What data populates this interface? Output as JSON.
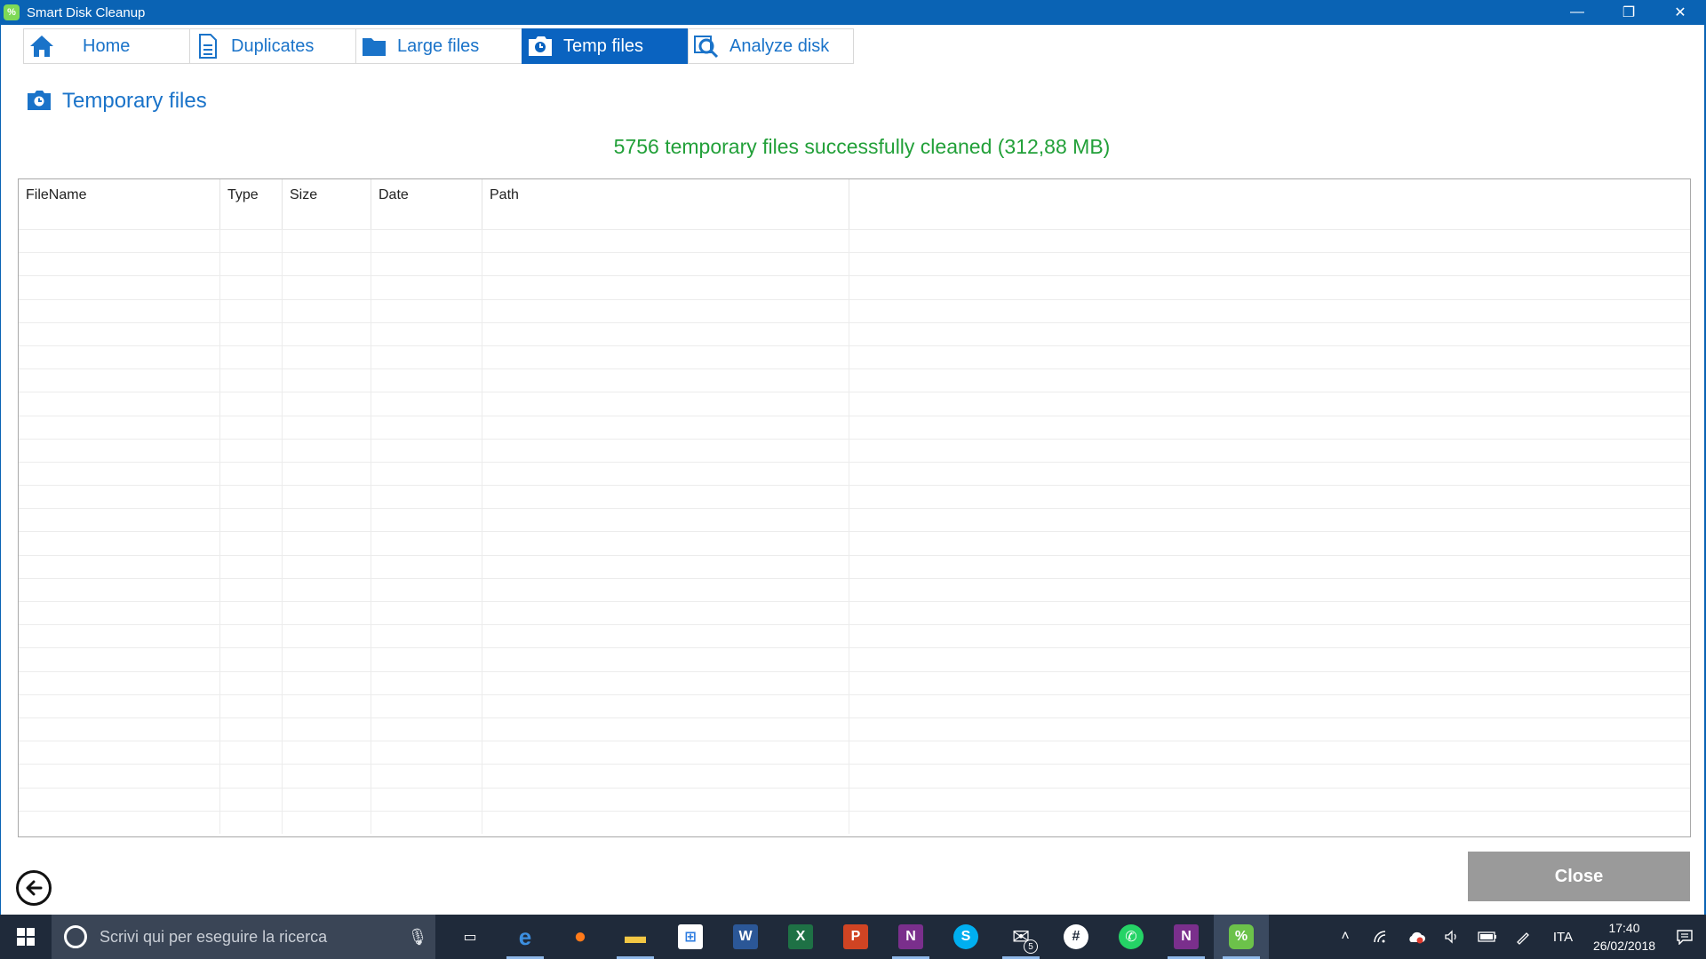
{
  "window": {
    "title": "Smart Disk Cleanup",
    "app_icon_letter": "%",
    "controls": {
      "minimize": "—",
      "restore": "❐",
      "close": "✕"
    }
  },
  "tabs": [
    {
      "label": "Home",
      "icon": "home-icon",
      "active": false
    },
    {
      "label": "Duplicates",
      "icon": "document-icon",
      "active": false
    },
    {
      "label": "Large files",
      "icon": "folder-icon",
      "active": false
    },
    {
      "label": "Temp files",
      "icon": "temp-files-icon",
      "active": true
    },
    {
      "label": "Analyze disk",
      "icon": "magnifier-icon",
      "active": false
    }
  ],
  "section": {
    "title": "Temporary files",
    "icon": "temp-files-icon"
  },
  "status_message": "5756 temporary files successfully cleaned (312,88 MB)",
  "colors": {
    "accent": "#0a63c0",
    "link": "#1a73c9",
    "success": "#22a039",
    "close_button": "#9a9a9a",
    "taskbar": "#1f2a3a"
  },
  "table": {
    "columns": [
      "FileName",
      "Type",
      "Size",
      "Date",
      "Path"
    ],
    "rows": []
  },
  "buttons": {
    "close_label": "Close",
    "back_icon": "back-arrow-icon"
  },
  "taskbar": {
    "search_placeholder": "Scrivi qui per eseguire la ricerca",
    "apps": [
      {
        "name": "task-view",
        "glyph": "▭"
      },
      {
        "name": "edge",
        "glyph": "e"
      },
      {
        "name": "firefox",
        "glyph": "●"
      },
      {
        "name": "file-explorer",
        "glyph": "▬"
      },
      {
        "name": "store",
        "glyph": "⊞"
      },
      {
        "name": "word",
        "glyph": "W"
      },
      {
        "name": "excel",
        "glyph": "X"
      },
      {
        "name": "powerpoint",
        "glyph": "P"
      },
      {
        "name": "onenote",
        "glyph": "N"
      },
      {
        "name": "skype",
        "glyph": "S"
      },
      {
        "name": "mail",
        "glyph": "✉",
        "badge": "5"
      },
      {
        "name": "slack",
        "glyph": "#"
      },
      {
        "name": "whatsapp",
        "glyph": "✆"
      },
      {
        "name": "onenote-2016",
        "glyph": "N"
      },
      {
        "name": "smart-disk-cleanup",
        "glyph": "%"
      }
    ],
    "tray": {
      "language": "ITA",
      "time": "17:40",
      "date": "26/02/2018"
    }
  }
}
